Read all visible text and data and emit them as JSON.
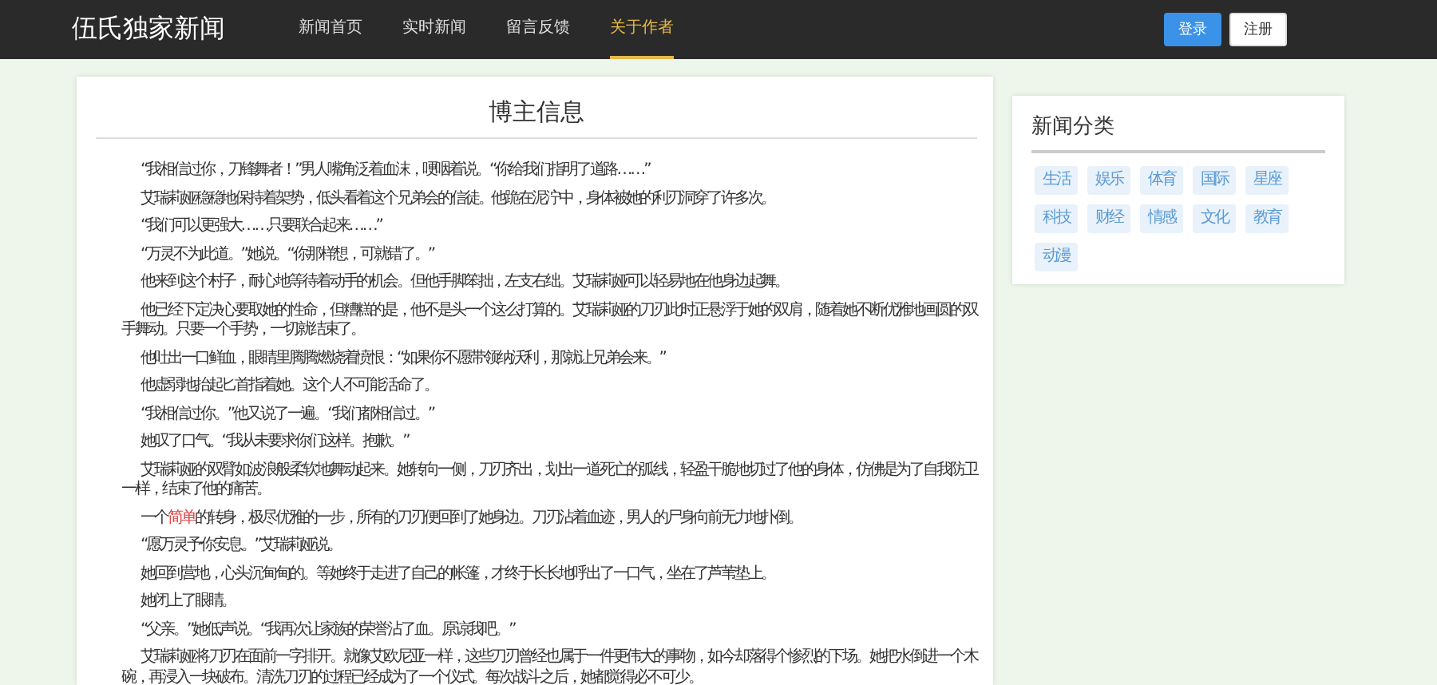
{
  "header": {
    "logo": "伍氏独家新闻",
    "nav": [
      {
        "label": "新闻首页",
        "selected": false
      },
      {
        "label": "实时新闻",
        "selected": false
      },
      {
        "label": "留言反馈",
        "selected": false
      },
      {
        "label": "关于作者",
        "selected": true
      }
    ],
    "buttons": [
      {
        "label": "登录",
        "kind": "primary"
      },
      {
        "label": "注册",
        "kind": "default"
      }
    ]
  },
  "article": {
    "title": "博主信息",
    "paragraphs": [
      [
        {
          "text": "“我相信过你，刀锋舞者！”男人嘴角泛着血沫，哽咽着说。“你给我们指明了道路……”",
          "highlight": false
        }
      ],
      [
        {
          "text": "艾瑞莉娅稳稳地保持着架势，低头看着这个兄弟会的信徒。他跪在泥泞中，身体被她的利刃洞穿了许多次。",
          "highlight": false
        }
      ],
      [
        {
          "text": "“我们可以更强大……只要联合起来……”",
          "highlight": false
        }
      ],
      [
        {
          "text": "“万灵不为此道。”她说。“你那样想，可就错了。”",
          "highlight": false
        }
      ],
      [
        {
          "text": "他来到这个村子，耐心地等待着动手的机会。但他手脚笨拙，左支右绌。艾瑞莉娅可以轻易地在他身边起舞。",
          "highlight": false
        }
      ],
      [
        {
          "text": "他已经下定决心要取她的性命，但糟糕的是，他不是头一个这么打算的。艾瑞莉娅的刀刃此时正悬浮于她的双肩，随着她不断优雅地画圆的双手舞动。只要一个手势，一切就结束了。",
          "highlight": false
        }
      ],
      [
        {
          "text": "他吐出一口鲜血，眼睛里腾腾燃烧着愤恨：“如果你不愿带领纳沃利，那就让兄弟会来。”",
          "highlight": false
        }
      ],
      [
        {
          "text": "他虚弱地抬起匕首指着她。这个人不可能活命了。",
          "highlight": false
        }
      ],
      [
        {
          "text": "“我相信过你。”他又说了一遍。“我们都相信过。”",
          "highlight": false
        }
      ],
      [
        {
          "text": "她叹了口气。“我从未要求你们这样。抱歉。”",
          "highlight": false
        }
      ],
      [
        {
          "text": "艾瑞莉娅的双臂如波浪般柔软地舞动起来。她转向一侧，刀刃齐出，划出一道死亡的弧线，轻盈干脆地切过了他的身体，仿佛是为了自我防卫一样，结束了他的痛苦。",
          "highlight": false
        }
      ],
      [
        {
          "text": "一个",
          "highlight": false
        },
        {
          "text": "简单",
          "highlight": true
        },
        {
          "text": "的转身，极尽优雅的一步，所有的刀刃便回到了她身边。刀刃沾着血迹，男人的尸身向前无力地扑倒。",
          "highlight": false
        }
      ],
      [
        {
          "text": "“愿万灵予你安息。”艾瑞莉娅说。",
          "highlight": false
        }
      ],
      [
        {
          "text": "她回到营地，心头沉甸甸的。等她终于走进了自己的帐篷，才终于长长地呼出了一口气，坐在了芦苇垫上。",
          "highlight": false
        }
      ],
      [
        {
          "text": "她闭上了眼睛。",
          "highlight": false
        }
      ],
      [
        {
          "text": "“父亲。”她低声说。“我再次让家族的荣誉沾了血。原谅我吧。”",
          "highlight": false
        }
      ],
      [
        {
          "text": "艾瑞莉娅将刀刃在面前一字排开。就像艾欧尼亚一样，这些刀刃曾经也属于一件更伟大的事物，如今却落得个惨烈的下场。她把水倒进一个木碗，再浸入一块破布。清洗刀刃的过程已经成为了一个仪式。每次战斗之后，她都觉得必不可少。",
          "highlight": false
        }
      ]
    ]
  },
  "sidebar": {
    "title": "新闻分类",
    "tags": [
      "生活",
      "娱乐",
      "体育",
      "国际",
      "星座",
      "科技",
      "财经",
      "情感",
      "文化",
      "教育",
      "动漫"
    ]
  }
}
